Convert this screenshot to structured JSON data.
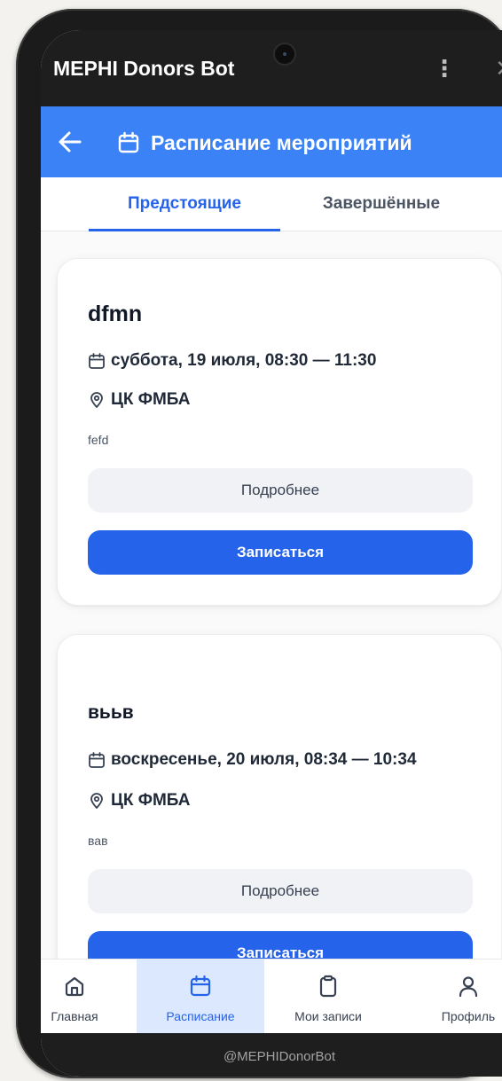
{
  "telegram": {
    "bot_name": "MEPHI Donors Bot",
    "menu_icon": "kebab-menu-icon",
    "close_icon": "close-icon"
  },
  "appbar": {
    "title": "Расписание мероприятий",
    "back_icon": "arrow-left-icon",
    "title_icon": "calendar-icon"
  },
  "tabs": [
    {
      "label": "Предстоящие",
      "active": true
    },
    {
      "label": "Завершённые",
      "active": false
    }
  ],
  "events": [
    {
      "title": "dfmn",
      "date": "суббота, 19 июля, 08:30 — 11:30",
      "location": "ЦК ФМБА",
      "description": "fefd",
      "details_label": "Подробнее",
      "signup_label": "Записаться"
    },
    {
      "title": "вььв",
      "date": "воскресенье, 20 июля, 08:34 — 10:34",
      "location": "ЦК ФМБА",
      "description": "вав",
      "details_label": "Подробнее",
      "signup_label": "Записаться"
    }
  ],
  "bottom_nav": [
    {
      "label": "Главная",
      "icon": "home-icon",
      "active": false
    },
    {
      "label": "Расписание",
      "icon": "calendar-icon",
      "active": true
    },
    {
      "label": "Мои записи",
      "icon": "clipboard-icon",
      "active": false
    },
    {
      "label": "Профиль",
      "icon": "user-icon",
      "active": false
    }
  ],
  "footer": {
    "handle": "@MEPHIDonorBot"
  },
  "colors": {
    "primary": "#2563eb",
    "appbar": "#3b82f6",
    "header_dark": "#1e1e1e",
    "nav_active_bg": "#dbe8fd"
  }
}
